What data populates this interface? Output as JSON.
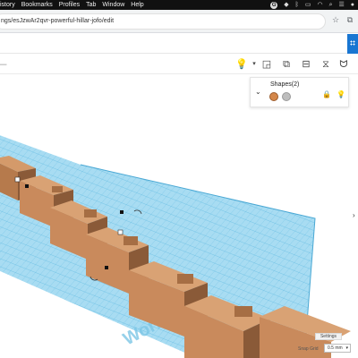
{
  "menubar": {
    "items": [
      "istory",
      "Bookmarks",
      "Profiles",
      "Tab",
      "Window",
      "Help"
    ],
    "status_icons": [
      "google-icon",
      "dropbox-icon",
      "bluetooth-icon",
      "battery-icon",
      "wifi-icon",
      "search-icon",
      "control-center-icon",
      "profile-icon"
    ]
  },
  "browser": {
    "url": "ngs/esJzwAr2qvr-powerful-hillar-jofo/edit"
  },
  "shapes_panel": {
    "title": "Shapes(2)",
    "colors": [
      "#d4874a",
      "#bdbdbd"
    ]
  },
  "viewport": {
    "workplane_label": "Workpl"
  },
  "bottom": {
    "settings_label": "Settings",
    "snap_label": "Snap Grid",
    "snap_value": "0.5 mm"
  },
  "colors": {
    "grid_blue": "#9ed8f0",
    "grid_line": "#5ab7e0",
    "shape_orange": "#c98a5c",
    "shape_dark": "#8a5a38",
    "accent": "#1976d2"
  }
}
